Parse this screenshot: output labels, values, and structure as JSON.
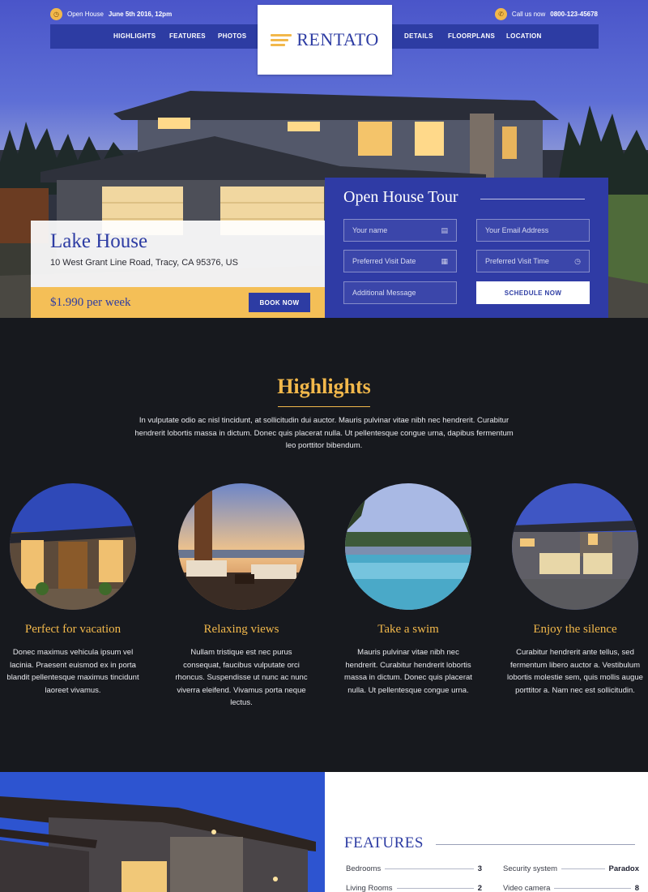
{
  "topbar": {
    "open_house_label": "Open House",
    "open_house_date": "June 5th 2016, 12pm",
    "call_label": "Call us now",
    "phone": "0800-123-45678"
  },
  "nav": {
    "left": [
      "HIGHLIGHTS",
      "FEATURES",
      "PHOTOS"
    ],
    "right": [
      "DETAILS",
      "FLOORPLANS",
      "LOCATION"
    ]
  },
  "logo": {
    "text": "RENTATO"
  },
  "listing": {
    "title": "Lake House",
    "address": "10 West Grant Line Road, Tracy, CA 95376, US",
    "price": "$1.990 per week",
    "book_label": "BOOK NOW"
  },
  "tour": {
    "title": "Open House Tour",
    "name_placeholder": "Your name",
    "email_placeholder": "Your Email Address",
    "date_placeholder": "Preferred Visit Date",
    "time_placeholder": "Preferred Visit Time",
    "message_placeholder": "Additional Message",
    "submit_label": "SCHEDULE NOW"
  },
  "highlights": {
    "title": "Highlights",
    "intro": "In vulputate odio ac nisl tincidunt, at sollicitudin dui auctor. Mauris pulvinar vitae nibh nec hendrerit. Curabitur hendrerit lobortis massa in dictum. Donec quis placerat nulla. Ut pellentesque congue urna, dapibus fermentum leo porttitor bibendum.",
    "items": [
      {
        "title": "Perfect for vacation",
        "text": "Donec maximus vehicula ipsum vel lacinia. Praesent euismod ex in porta blandit pellentesque maximus tincidunt laoreet vivamus."
      },
      {
        "title": "Relaxing views",
        "text": "Nullam tristique est nec purus consequat, faucibus vulputate orci rhoncus. Suspendisse ut nunc ac nunc viverra eleifend. Vivamus porta neque lectus."
      },
      {
        "title": "Take a swim",
        "text": "Mauris pulvinar vitae nibh nec hendrerit. Curabitur hendrerit lobortis massa in dictum. Donec quis placerat nulla. Ut pellentesque congue urna."
      },
      {
        "title": "Enjoy the silence",
        "text": "Curabitur hendrerit ante tellus, sed fermentum libero auctor a. Vestibulum lobortis molestie sem, quis mollis augue porttitor a. Nam nec est sollicitudin."
      }
    ]
  },
  "features": {
    "heading": "FEATURES",
    "specs": [
      {
        "label": "Bedrooms",
        "value": "3"
      },
      {
        "label": "Security system",
        "value": "Paradox"
      },
      {
        "label": "Living Rooms",
        "value": "2"
      },
      {
        "label": "Video camera",
        "value": "8"
      }
    ]
  },
  "colors": {
    "brand_blue": "#2d3ca3",
    "accent_gold": "#f2b84b",
    "dark_bg": "#17191e"
  }
}
